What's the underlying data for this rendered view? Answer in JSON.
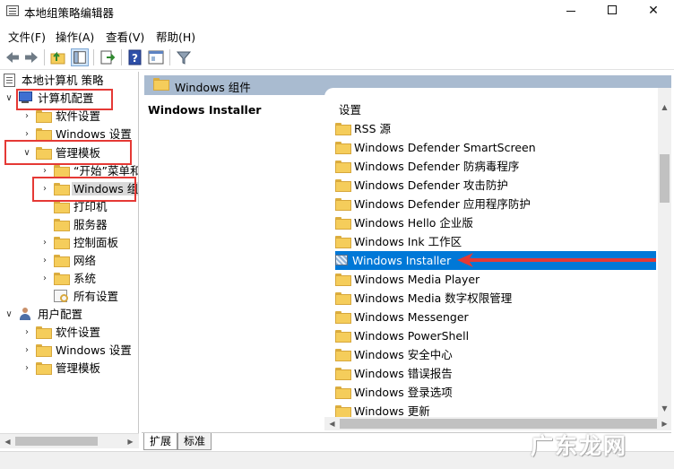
{
  "window": {
    "title": "本地组策略编辑器",
    "minimize": "—",
    "close": "✕"
  },
  "menu": {
    "items": [
      "文件(F)",
      "操作(A)",
      "查看(V)",
      "帮助(H)"
    ]
  },
  "tree": {
    "root": "本地计算机 策略",
    "computer_config": "计算机配置",
    "software_settings": "软件设置",
    "windows_settings": "Windows 设置",
    "admin_templates": "管理模板",
    "start_menu": "“开始”菜单和",
    "windows_components": "Windows 组件",
    "printers": "打印机",
    "server": "服务器",
    "control_panel": "控制面板",
    "network": "网络",
    "system": "系统",
    "all_settings": "所有设置",
    "user_config": "用户配置",
    "user_software_settings": "软件设置",
    "user_windows_settings": "Windows 设置",
    "user_admin_templates": "管理模板"
  },
  "right": {
    "header": "Windows 组件",
    "description_title": "Windows Installer",
    "column_header": "设置",
    "items": [
      "RSS 源",
      "Windows Defender SmartScreen",
      "Windows Defender 防病毒程序",
      "Windows Defender 攻击防护",
      "Windows Defender 应用程序防护",
      "Windows Hello 企业版",
      "Windows Ink 工作区",
      "Windows Installer",
      "Windows Media Player",
      "Windows Media 数字权限管理",
      "Windows Messenger",
      "Windows PowerShell",
      "Windows 安全中心",
      "Windows 错误报告",
      "Windows 登录选项",
      "Windows 更新"
    ],
    "selected_index": 7
  },
  "tabs": {
    "extended": "扩展",
    "standard": "标准"
  },
  "watermark": "广东龙网",
  "colors": {
    "selection": "#0078d7",
    "header_band": "#a9bbd0",
    "annotation": "#e53935"
  }
}
